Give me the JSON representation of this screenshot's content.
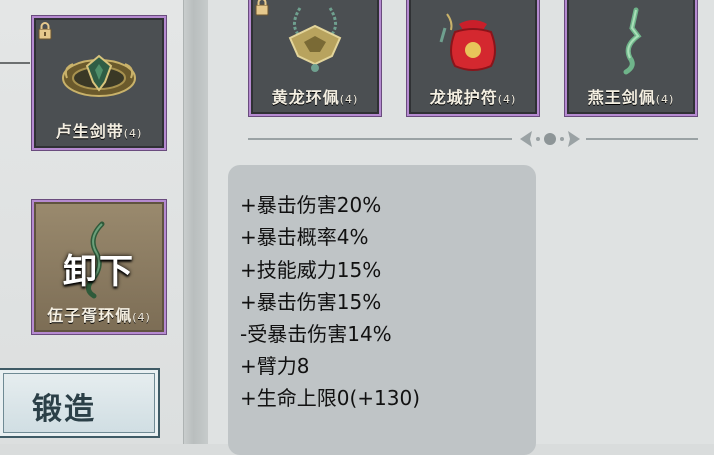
{
  "left_slots": [
    {
      "name": "卢生剑带",
      "count": "(4)",
      "locked": true,
      "icon": "belt-icon"
    },
    {
      "name": "伍子胥环佩",
      "count": "(4)",
      "locked": false,
      "icon": "pendant-icon"
    }
  ],
  "unequip_label": "卸下",
  "forge_label": "锻造",
  "top_items": [
    {
      "name": "黄龙环佩",
      "count": "(4)",
      "locked": true,
      "icon": "jade-pendant-icon"
    },
    {
      "name": "龙城护符",
      "count": "(4)",
      "locked": false,
      "icon": "red-pouch-icon"
    },
    {
      "name": "燕王剑佩",
      "count": "(4)",
      "locked": false,
      "icon": "green-sword-pendant-icon"
    }
  ],
  "stats": [
    "+暴击伤害20%",
    "+暴击概率4%",
    "+技能威力15%",
    "+暴击伤害15%",
    "-受暴击伤害14%",
    "+臂力8",
    "+生命上限0(+130)"
  ],
  "colors": {
    "slot_border": "#b58ad0",
    "slot_bg": "#4b4f52",
    "forge_text": "#2b3f47"
  }
}
